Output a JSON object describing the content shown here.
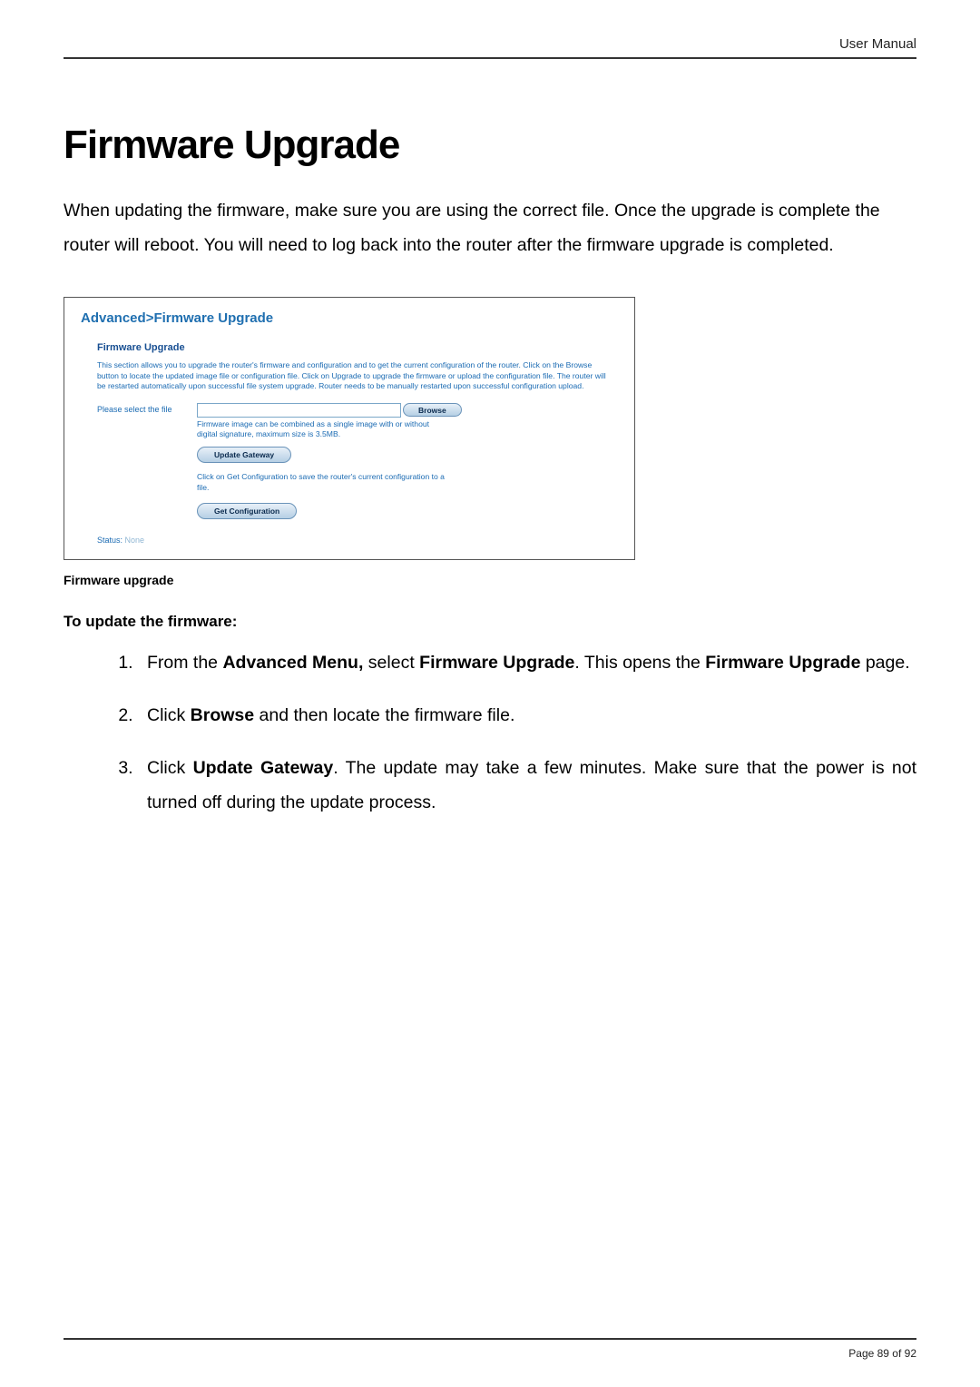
{
  "header": {
    "label": "User Manual"
  },
  "title": "Firmware Upgrade",
  "intro": "When updating the firmware, make sure you are using the correct file. Once the upgrade is complete the router will reboot. You will need to log back into the router after the firmware upgrade is completed.",
  "panel": {
    "breadcrumb": "Advanced>Firmware Upgrade",
    "section_title": "Firmware Upgrade",
    "description": "This section allows you to upgrade the router's firmware and configuration and to get the current configuration of the router. Click on the Browse button to locate the updated image file or configuration file. Click on Upgrade to upgrade the firmware or upload the configuration file. The router will be restarted automatically upon successful file system upgrade. Router needs to be manually restarted upon successful configuration upload.",
    "row_label": "Please select the file",
    "browse_btn": "Browse",
    "hint": "Firmware image can be combined as a single image with or without digital signature, maximum size is 3.5MB.",
    "update_btn": "Update Gateway",
    "getconf_text": "Click on Get Configuration to save the router's current configuration to a file.",
    "getconf_btn": "Get Configuration",
    "status_label": "Status:",
    "status_value": "None"
  },
  "caption": "Firmware upgrade",
  "steps_title": "To update the firmware:",
  "steps": {
    "s1a": "From the ",
    "s1b": "Advanced Menu,",
    "s1c": " select ",
    "s1d": "Firmware Upgrade",
    "s1e": ". This opens the ",
    "s1f": "Firmware Upgrade",
    "s1g": " page.",
    "s2a": "Click ",
    "s2b": "Browse",
    "s2c": " and then locate the firmware file.",
    "s3a": "Click ",
    "s3b": "Update Gateway",
    "s3c": ". The update may take a few minutes. Make sure that the power is not turned off during the update process."
  },
  "footer": {
    "text": "Page 89 of 92"
  }
}
